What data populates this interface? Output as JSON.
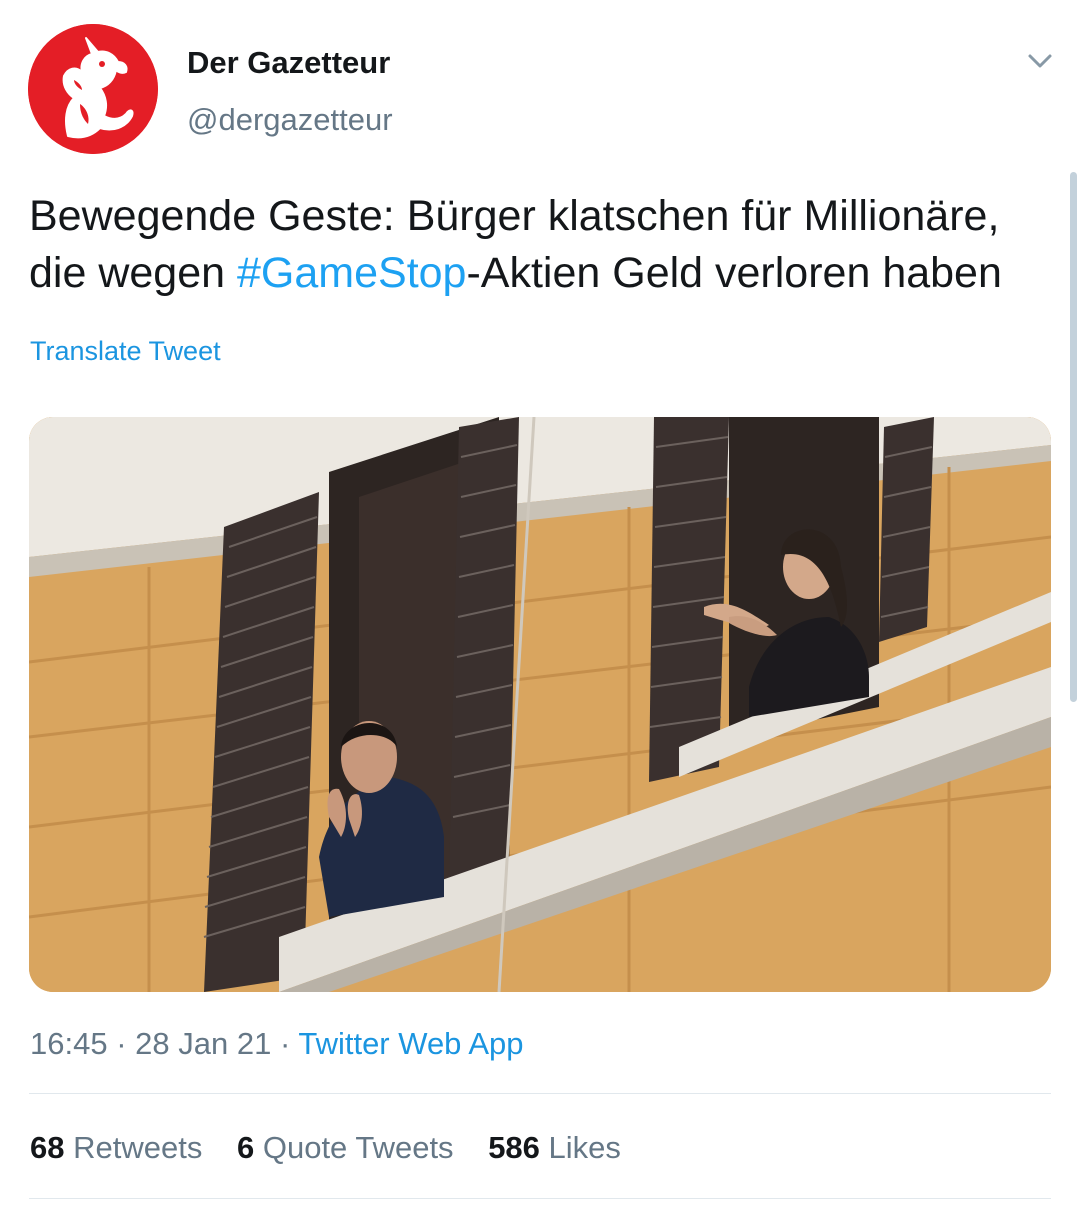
{
  "author": {
    "display_name": "Der Gazetteur",
    "handle": "@dergazetteur",
    "avatar_icon": "unicorn-logo-icon",
    "avatar_color": "#e41e26"
  },
  "tweet": {
    "text_part1": "Bewegende Geste: Bürger klatschen für Millionäre,",
    "text_part2_prefix": "die wegen ",
    "hashtag": "#GameStop",
    "text_part2_suffix": "-Aktien Geld verloren haben",
    "translate_label": "Translate Tweet",
    "time": "16:45",
    "date": "28 Jan 21",
    "separator": "·",
    "source": "Twitter Web App"
  },
  "stats": {
    "retweets_count": "68",
    "retweets_label": "Retweets",
    "quote_tweets_count": "6",
    "quote_tweets_label": "Quote Tweets",
    "likes_count": "586",
    "likes_label": "Likes"
  },
  "colors": {
    "link": "#1da1f2",
    "text": "#14171a",
    "secondary": "#657786"
  }
}
